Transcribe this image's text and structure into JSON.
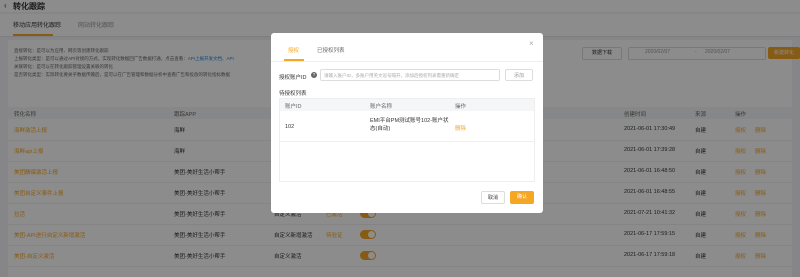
{
  "header": {
    "back_icon": "chevron-left-icon",
    "title": "转化跟踪"
  },
  "tabs": [
    {
      "label": "移动应用转化跟踪",
      "active": true
    },
    {
      "label": "网站转化跟踪",
      "active": false
    }
  ],
  "notes": [
    {
      "prefix": "直接转化：是可以为应用、网页等创建转化跟踪",
      "link": ""
    },
    {
      "prefix": "上报转化类型：是可以通过API对接的方式，实现转化数据回广告数据打通，点击查看：",
      "link": "API上报开发文档、API"
    },
    {
      "prefix": "关联转化：是可以在转化跟踪管理设置关联的转化",
      "link": ""
    },
    {
      "prefix": "是否转化类型：实际转化要关乎数据传输后，是可以在广告管理和数据分析中查看广告和投放的转化指标数据",
      "link": ""
    }
  ],
  "toolbar": {
    "download": "数据下载",
    "date_start": "2020/02/07",
    "date_end": "2020/02/07",
    "date_sep": "-",
    "new_button": "新建转化"
  },
  "table": {
    "headers": [
      "转化名称",
      "跟踪APP",
      "",
      "",
      "",
      "",
      "",
      "创建时间",
      "来源",
      "操作"
    ],
    "rows": [
      {
        "name": "海鲜激活上报",
        "app": "海鲜",
        "c3": "",
        "c4": "",
        "toggle": false,
        "created": "2021-06-01 17:30:49",
        "source": "自建",
        "ops": [
          "授权",
          "删除"
        ]
      },
      {
        "name": "海鲜api上报",
        "app": "海鲜",
        "c3": "",
        "c4": "",
        "toggle": false,
        "created": "2021-06-01 17:39:28",
        "source": "自建",
        "ops": [
          "授权",
          "删除"
        ]
      },
      {
        "name": "美团酬爆激活上报",
        "app": "美团-美好生活小帮手",
        "c3": "",
        "c4": "",
        "toggle": false,
        "created": "2021-06-01 16:48:50",
        "source": "自建",
        "ops": [
          "授权",
          "删除"
        ]
      },
      {
        "name": "美团自定义事件上报",
        "app": "美团-美好生活小帮手",
        "c3": "",
        "c4": "",
        "toggle": false,
        "created": "2021-06-01 16:48:55",
        "source": "自建",
        "ops": [
          "授权",
          "删除"
        ]
      },
      {
        "name": "拉活",
        "app": "美团-美好生活小帮手",
        "c3": "自定义激活",
        "c4": "已激活",
        "toggle": true,
        "created": "2021-07-21 10:41:32",
        "source": "自建",
        "ops": [
          "授权",
          "删除"
        ]
      },
      {
        "name": "美团-API进行自定义新增激活",
        "app": "美团-美好生活小帮手",
        "c3": "自定义新增激活",
        "c4": "待验证",
        "toggle": true,
        "created": "2021-06-17 17:59:15",
        "source": "自建",
        "ops": [
          "授权",
          "删除"
        ]
      },
      {
        "name": "美团-自定义激活",
        "app": "美团-美好生活小帮手",
        "c3": "自定义激活",
        "c4": "",
        "toggle": true,
        "created": "2021-06-17 17:59:18",
        "source": "自建",
        "ops": [
          "授权",
          "删除"
        ]
      }
    ]
  },
  "modal": {
    "close_icon": "close-icon",
    "tabs": [
      {
        "label": "授权",
        "active": true
      },
      {
        "label": "已授权列表",
        "active": false
      }
    ],
    "field_label": "授权账户ID",
    "help_icon": "question-icon",
    "input_placeholder": "请输入账户ID，多账户用英文逗号隔开，添加后授权列表需重新确定",
    "add_button": "添加",
    "list_title": "待授权列表",
    "list_headers": [
      "账户ID",
      "账户名称",
      "操作"
    ],
    "list_rows": [
      {
        "id": "102",
        "name": "EMI平台PM测试账号102-账户状态(自动)",
        "op": "删除"
      }
    ],
    "cancel_button": "取消",
    "ok_button": "确认"
  }
}
